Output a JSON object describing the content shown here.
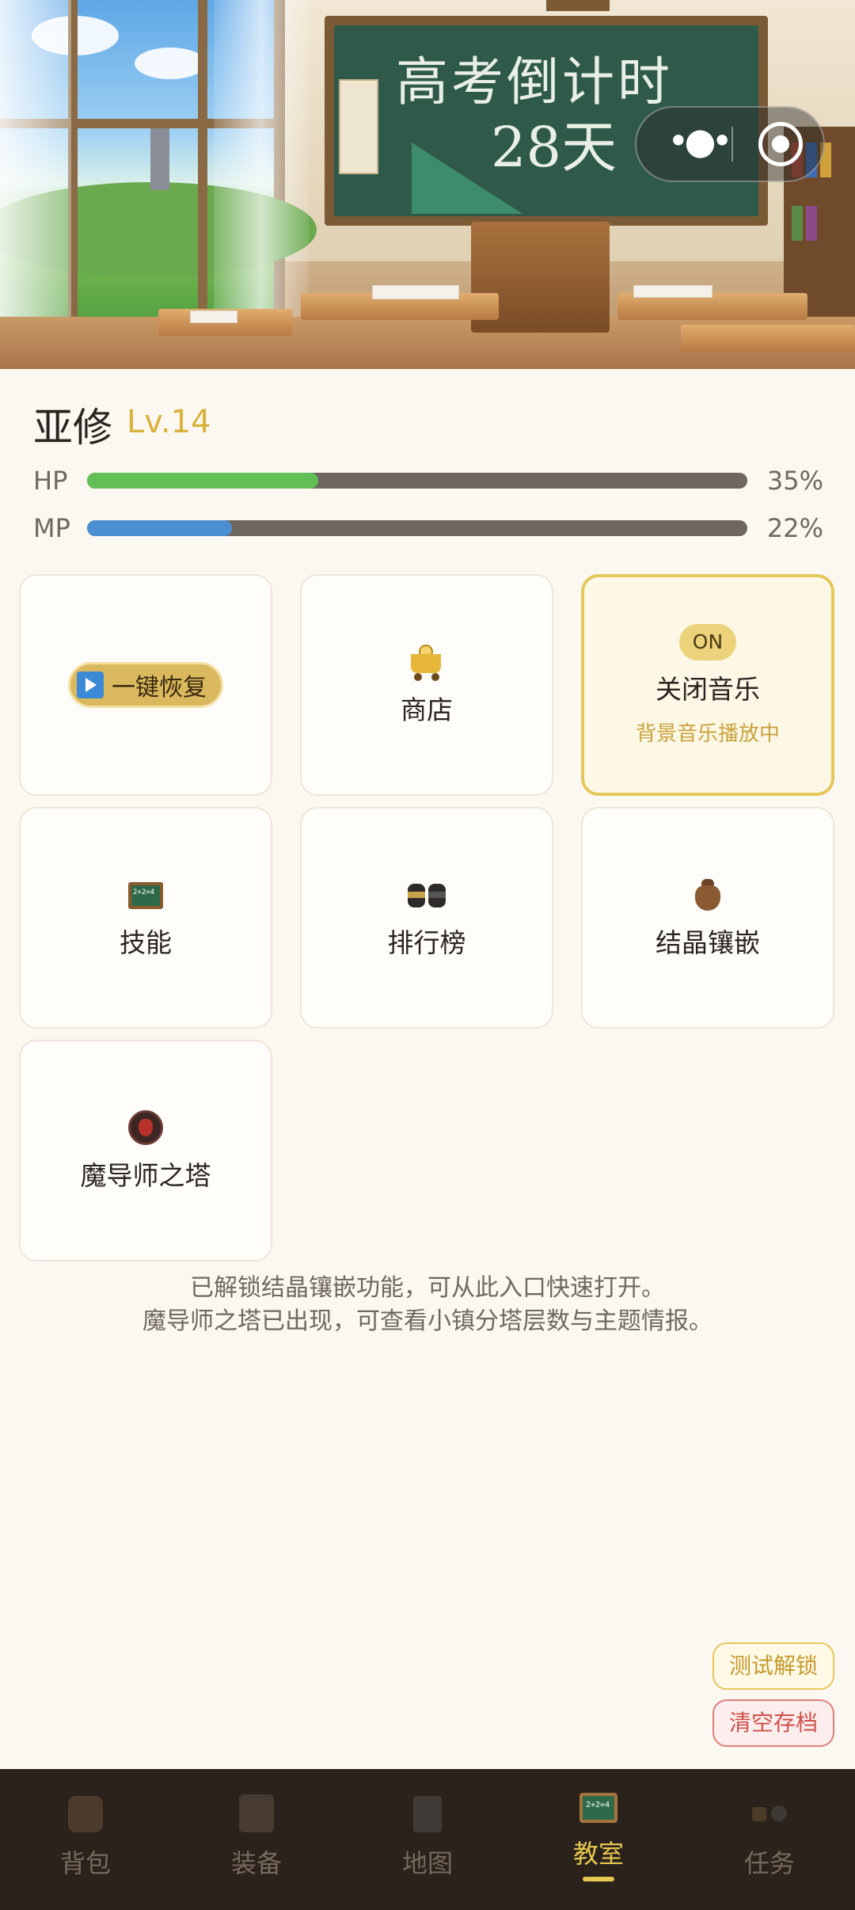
{
  "hero": {
    "blackboard_title": "高考倒计时",
    "blackboard_days": "28天"
  },
  "player": {
    "name": "亚修",
    "level": "Lv.14",
    "hp": {
      "label": "HP",
      "percent": 35,
      "percent_text": "35%",
      "color": "#62bf55"
    },
    "mp": {
      "label": "MP",
      "percent": 22,
      "percent_text": "22%",
      "color": "#4b8fd3"
    }
  },
  "cards": {
    "restore": {
      "label": "一键恢复",
      "icon": "play-icon"
    },
    "shop": {
      "label": "商店",
      "icon": "shopping-cart-icon"
    },
    "music": {
      "badge": "ON",
      "label": "关闭音乐",
      "sub": "背景音乐播放中",
      "active": true
    },
    "skills": {
      "label": "技能",
      "icon": "blackboard-icon"
    },
    "ranking": {
      "label": "排行榜",
      "icon": "ranking-jars-icon"
    },
    "crystal": {
      "label": "结晶镶嵌",
      "icon": "money-bag-icon"
    },
    "mage_tower": {
      "label": "魔导师之塔",
      "icon": "demon-mask-icon"
    }
  },
  "notice": {
    "line1": "已解锁结晶镶嵌功能，可从此入口快速打开。",
    "line2": "魔导师之塔已出现，可查看小镇分塔层数与主题情报。"
  },
  "debug": {
    "unlock_label": "测试解锁",
    "clear_label": "清空存档"
  },
  "tabbar": {
    "active": "教室",
    "tabs": [
      {
        "label": "背包",
        "icon": "backpack-icon"
      },
      {
        "label": "装备",
        "icon": "equipment-icon"
      },
      {
        "label": "地图",
        "icon": "map-icon"
      },
      {
        "label": "教室",
        "icon": "blackboard-icon"
      },
      {
        "label": "任务",
        "icon": "task-icon"
      }
    ]
  },
  "colors": {
    "accent": "#e5c64f",
    "background": "#fbf7f1",
    "tabbar": "#2b221c"
  }
}
